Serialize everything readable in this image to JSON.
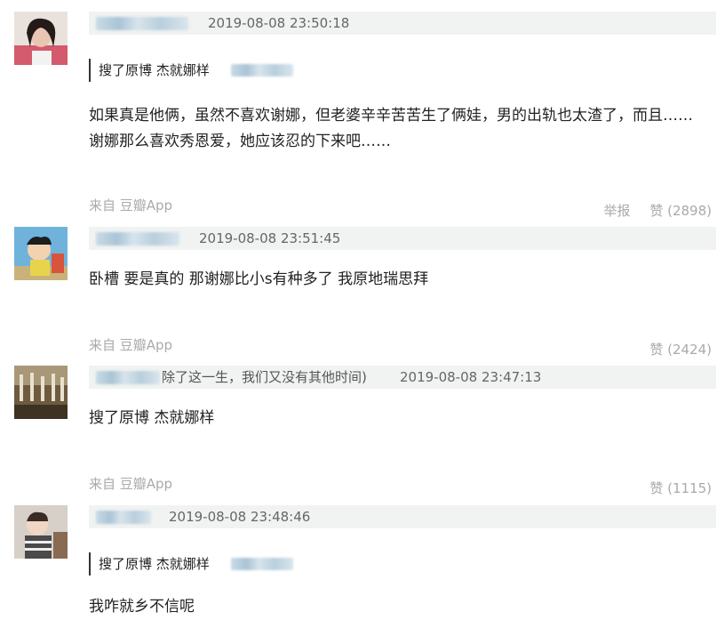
{
  "comments": [
    {
      "time": "2019-08-08 23:50:18",
      "quote": "搜了原博 杰就娜样",
      "content_lines": [
        "如果真是他俩，虽然不喜欢谢娜，但老婆辛辛苦苦生了俩娃，男的出轨也太渣了，而且……",
        "谢娜那么喜欢秀恩爱，她应该忍的下来吧……"
      ],
      "source": "来自 豆瓣App",
      "report": "举报",
      "like": "赞 (2898)"
    },
    {
      "time": "2019-08-08 23:51:45",
      "content_lines": [
        "卧槽 要是真的 那谢娜比小s有种多了 我原地瑞思拜"
      ],
      "source": "来自 豆瓣App",
      "like": "赞 (2424)"
    },
    {
      "time": "2019-08-08 23:47:13",
      "name_extra": "除了这一生，我们又没有其他时间)",
      "content_lines": [
        "搜了原博 杰就娜样"
      ],
      "source": "来自 豆瓣App",
      "like": "赞 (1115)"
    },
    {
      "time": "2019-08-08 23:48:46",
      "quote": "搜了原博 杰就娜样",
      "content_lines": [
        "我咋就乡不信呢"
      ]
    }
  ],
  "colors": {
    "meta_bar_bg": "#f0f3f1",
    "muted_text": "#aaaaaa",
    "body_text": "#222222"
  }
}
